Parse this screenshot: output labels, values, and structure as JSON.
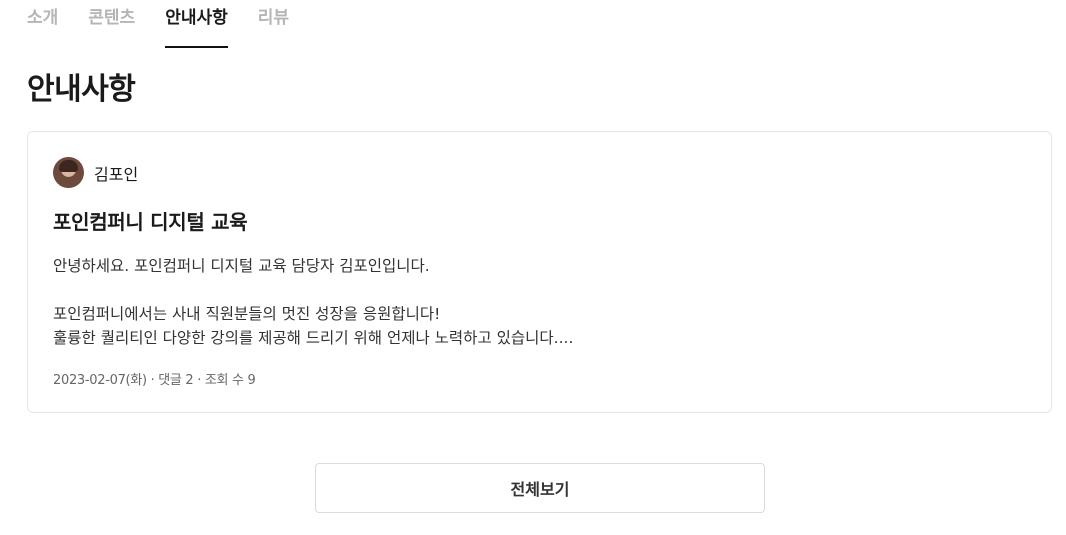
{
  "tabs": [
    {
      "label": "소개",
      "active": false
    },
    {
      "label": "콘텐츠",
      "active": false
    },
    {
      "label": "안내사항",
      "active": true
    },
    {
      "label": "리뷰",
      "active": false
    }
  ],
  "section": {
    "title": "안내사항"
  },
  "notice": {
    "author": "김포인",
    "title": "포인컴퍼니 디지털 교육",
    "body": [
      "안녕하세요. 포인컴퍼니 디지털 교육 담당자 김포인입니다.",
      "",
      "포인컴퍼니에서는 사내 직원분들의 멋진 성장을 응원합니다!",
      "훌륭한 퀄리티인 다양한 강의를 제공해 드리기 위해 언제나 노력하고 있습니다...."
    ],
    "meta": "2023-02-07(화) · 댓글 2 · 조회 수 9"
  },
  "view_all_label": "전체보기"
}
